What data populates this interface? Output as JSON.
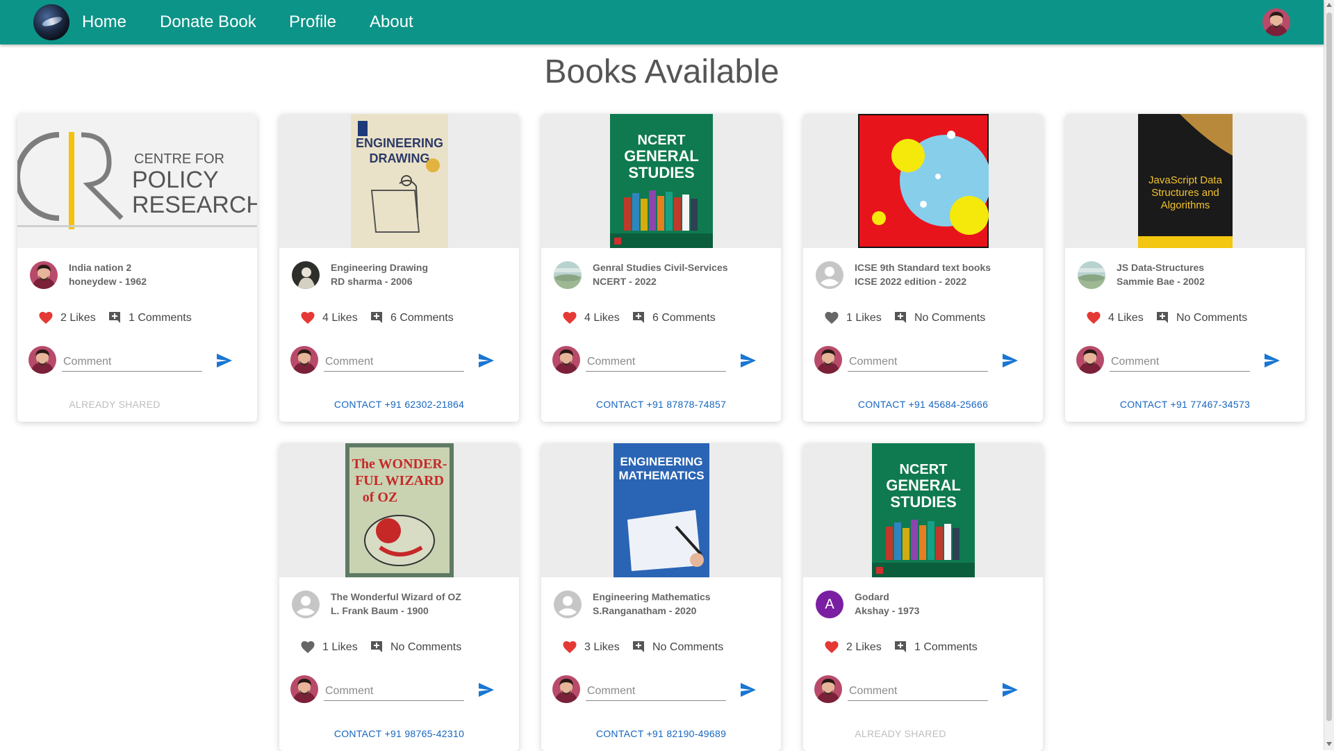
{
  "nav": {
    "home": "Home",
    "donate": "Donate Book",
    "profile": "Profile",
    "about": "About"
  },
  "page_title": "Books Available",
  "comment_placeholder": "Comment",
  "books": [
    {
      "title": "India nation 2",
      "subtitle": "honeydew - 1962",
      "likes": "2 Likes",
      "comments": "1 Comments",
      "liked": true,
      "contact": "ALREADY SHARED",
      "shared": true,
      "cover": {
        "line1": "CENTRE FOR",
        "line2": "POLICY",
        "line3": "RESEARCH"
      }
    },
    {
      "title": "Engineering Drawing",
      "subtitle": "RD sharma - 2006",
      "likes": "4 Likes",
      "comments": "6 Comments",
      "liked": true,
      "contact": "CONTACT +91 62302-21864",
      "shared": false,
      "cover": {
        "line1": "ENGINEERING",
        "line2": "DRAWING"
      }
    },
    {
      "title": "Genral Studies Civil-Services",
      "subtitle": "NCERT - 2022",
      "likes": "4 Likes",
      "comments": "6 Comments",
      "liked": true,
      "contact": "CONTACT +91 87878-74857",
      "shared": false,
      "cover": {
        "line1": "NCERT",
        "line2": "GENERAL",
        "line3": "STUDIES"
      }
    },
    {
      "title": "ICSE 9th Standard text books",
      "subtitle": "ICSE 2022 edition - 2022",
      "likes": "1 Likes",
      "comments": "No Comments",
      "liked": false,
      "contact": "CONTACT +91 45684-25666",
      "shared": false,
      "cover": {}
    },
    {
      "title": "JS Data-Structures",
      "subtitle": "Sammie Bae - 2002",
      "likes": "4 Likes",
      "comments": "No Comments",
      "liked": true,
      "contact": "CONTACT +91 77467-34573",
      "shared": false,
      "cover": {
        "line1": "JavaScript Data",
        "line2": "Structures and",
        "line3": "Algorithms"
      }
    },
    {
      "title": "The Wonderful Wizard of OZ",
      "subtitle": "L. Frank Baum - 1900",
      "likes": "1 Likes",
      "comments": "No Comments",
      "liked": false,
      "contact": "CONTACT +91 98765-42310",
      "shared": false,
      "cover": {
        "line1": "The WONDER-",
        "line2": "FUL WIZARD",
        "line3": "of OZ"
      }
    },
    {
      "title": "Engineering Mathematics",
      "subtitle": "S.Ranganatham - 2020",
      "likes": "3 Likes",
      "comments": "No Comments",
      "liked": true,
      "contact": "CONTACT +91 82190-49689",
      "shared": false,
      "cover": {
        "line1": "ENGINEERING",
        "line2": "MATHEMATICS"
      }
    },
    {
      "title": "Godard",
      "subtitle": "Akshay - 1973",
      "likes": "2 Likes",
      "comments": "1 Comments",
      "liked": true,
      "contact": "ALREADY SHARED",
      "shared": true,
      "owner_initial": "A",
      "cover": {
        "line1": "NCERT",
        "line2": "GENERAL",
        "line3": "STUDIES"
      }
    }
  ],
  "colors": {
    "nav": "#0d9488",
    "like_on": "#e53935",
    "like_off": "#666666",
    "contact": "#1565c0",
    "send": "#1976d2"
  }
}
